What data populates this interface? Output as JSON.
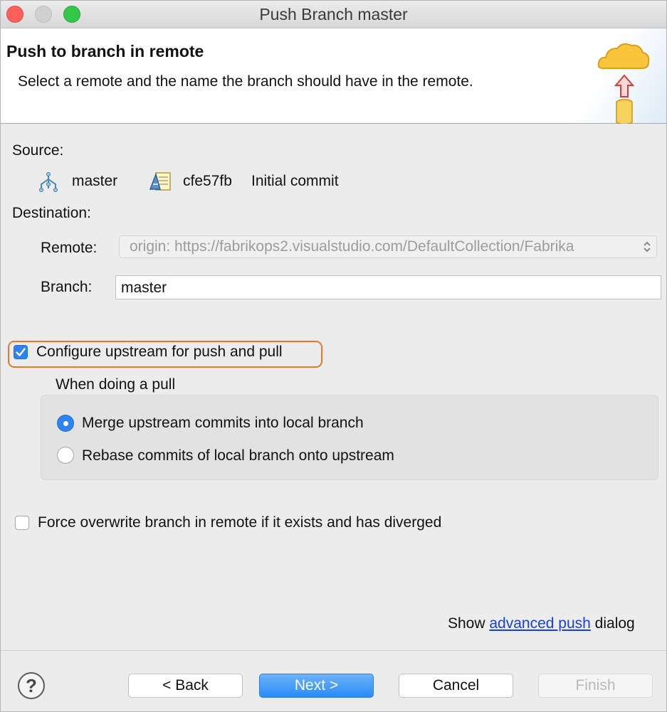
{
  "window": {
    "title": "Push Branch master"
  },
  "header": {
    "title": "Push to branch in remote",
    "description": "Select a remote and the name the branch should have in the remote."
  },
  "source": {
    "label": "Source:",
    "branch": "master",
    "commit_id": "cfe57fb",
    "commit_message": "Initial commit"
  },
  "destination": {
    "label": "Destination:",
    "remote_label": "Remote:",
    "remote_value": "origin: https://fabrikops2.visualstudio.com/DefaultCollection/Fabrika",
    "branch_label": "Branch:",
    "branch_value": "master"
  },
  "options": {
    "configure_upstream": {
      "label": "Configure upstream for push and pull",
      "checked": true
    },
    "pull_group_label": "When doing a pull",
    "merge": {
      "label": "Merge upstream commits into local branch",
      "selected": true
    },
    "rebase": {
      "label": "Rebase commits of local branch onto upstream",
      "selected": false
    },
    "force_overwrite": {
      "label": "Force overwrite branch in remote if it exists and has diverged",
      "checked": false
    }
  },
  "advanced": {
    "prefix": "Show",
    "link": "advanced push",
    "suffix": "dialog"
  },
  "footer": {
    "help": "?",
    "back": "< Back",
    "next": "Next >",
    "cancel": "Cancel",
    "finish": "Finish"
  },
  "colors": {
    "accent": "#2f82f0",
    "highlight": "#e8772e",
    "link": "#1a3fd6",
    "title_close": "#fc605c",
    "title_zoom": "#34c84a"
  },
  "icons": {
    "branch": "branch-icon",
    "commit": "commit-icon",
    "wizard": "cloud-push-icon",
    "checkmark": "checkmark-icon",
    "help": "help-icon"
  }
}
